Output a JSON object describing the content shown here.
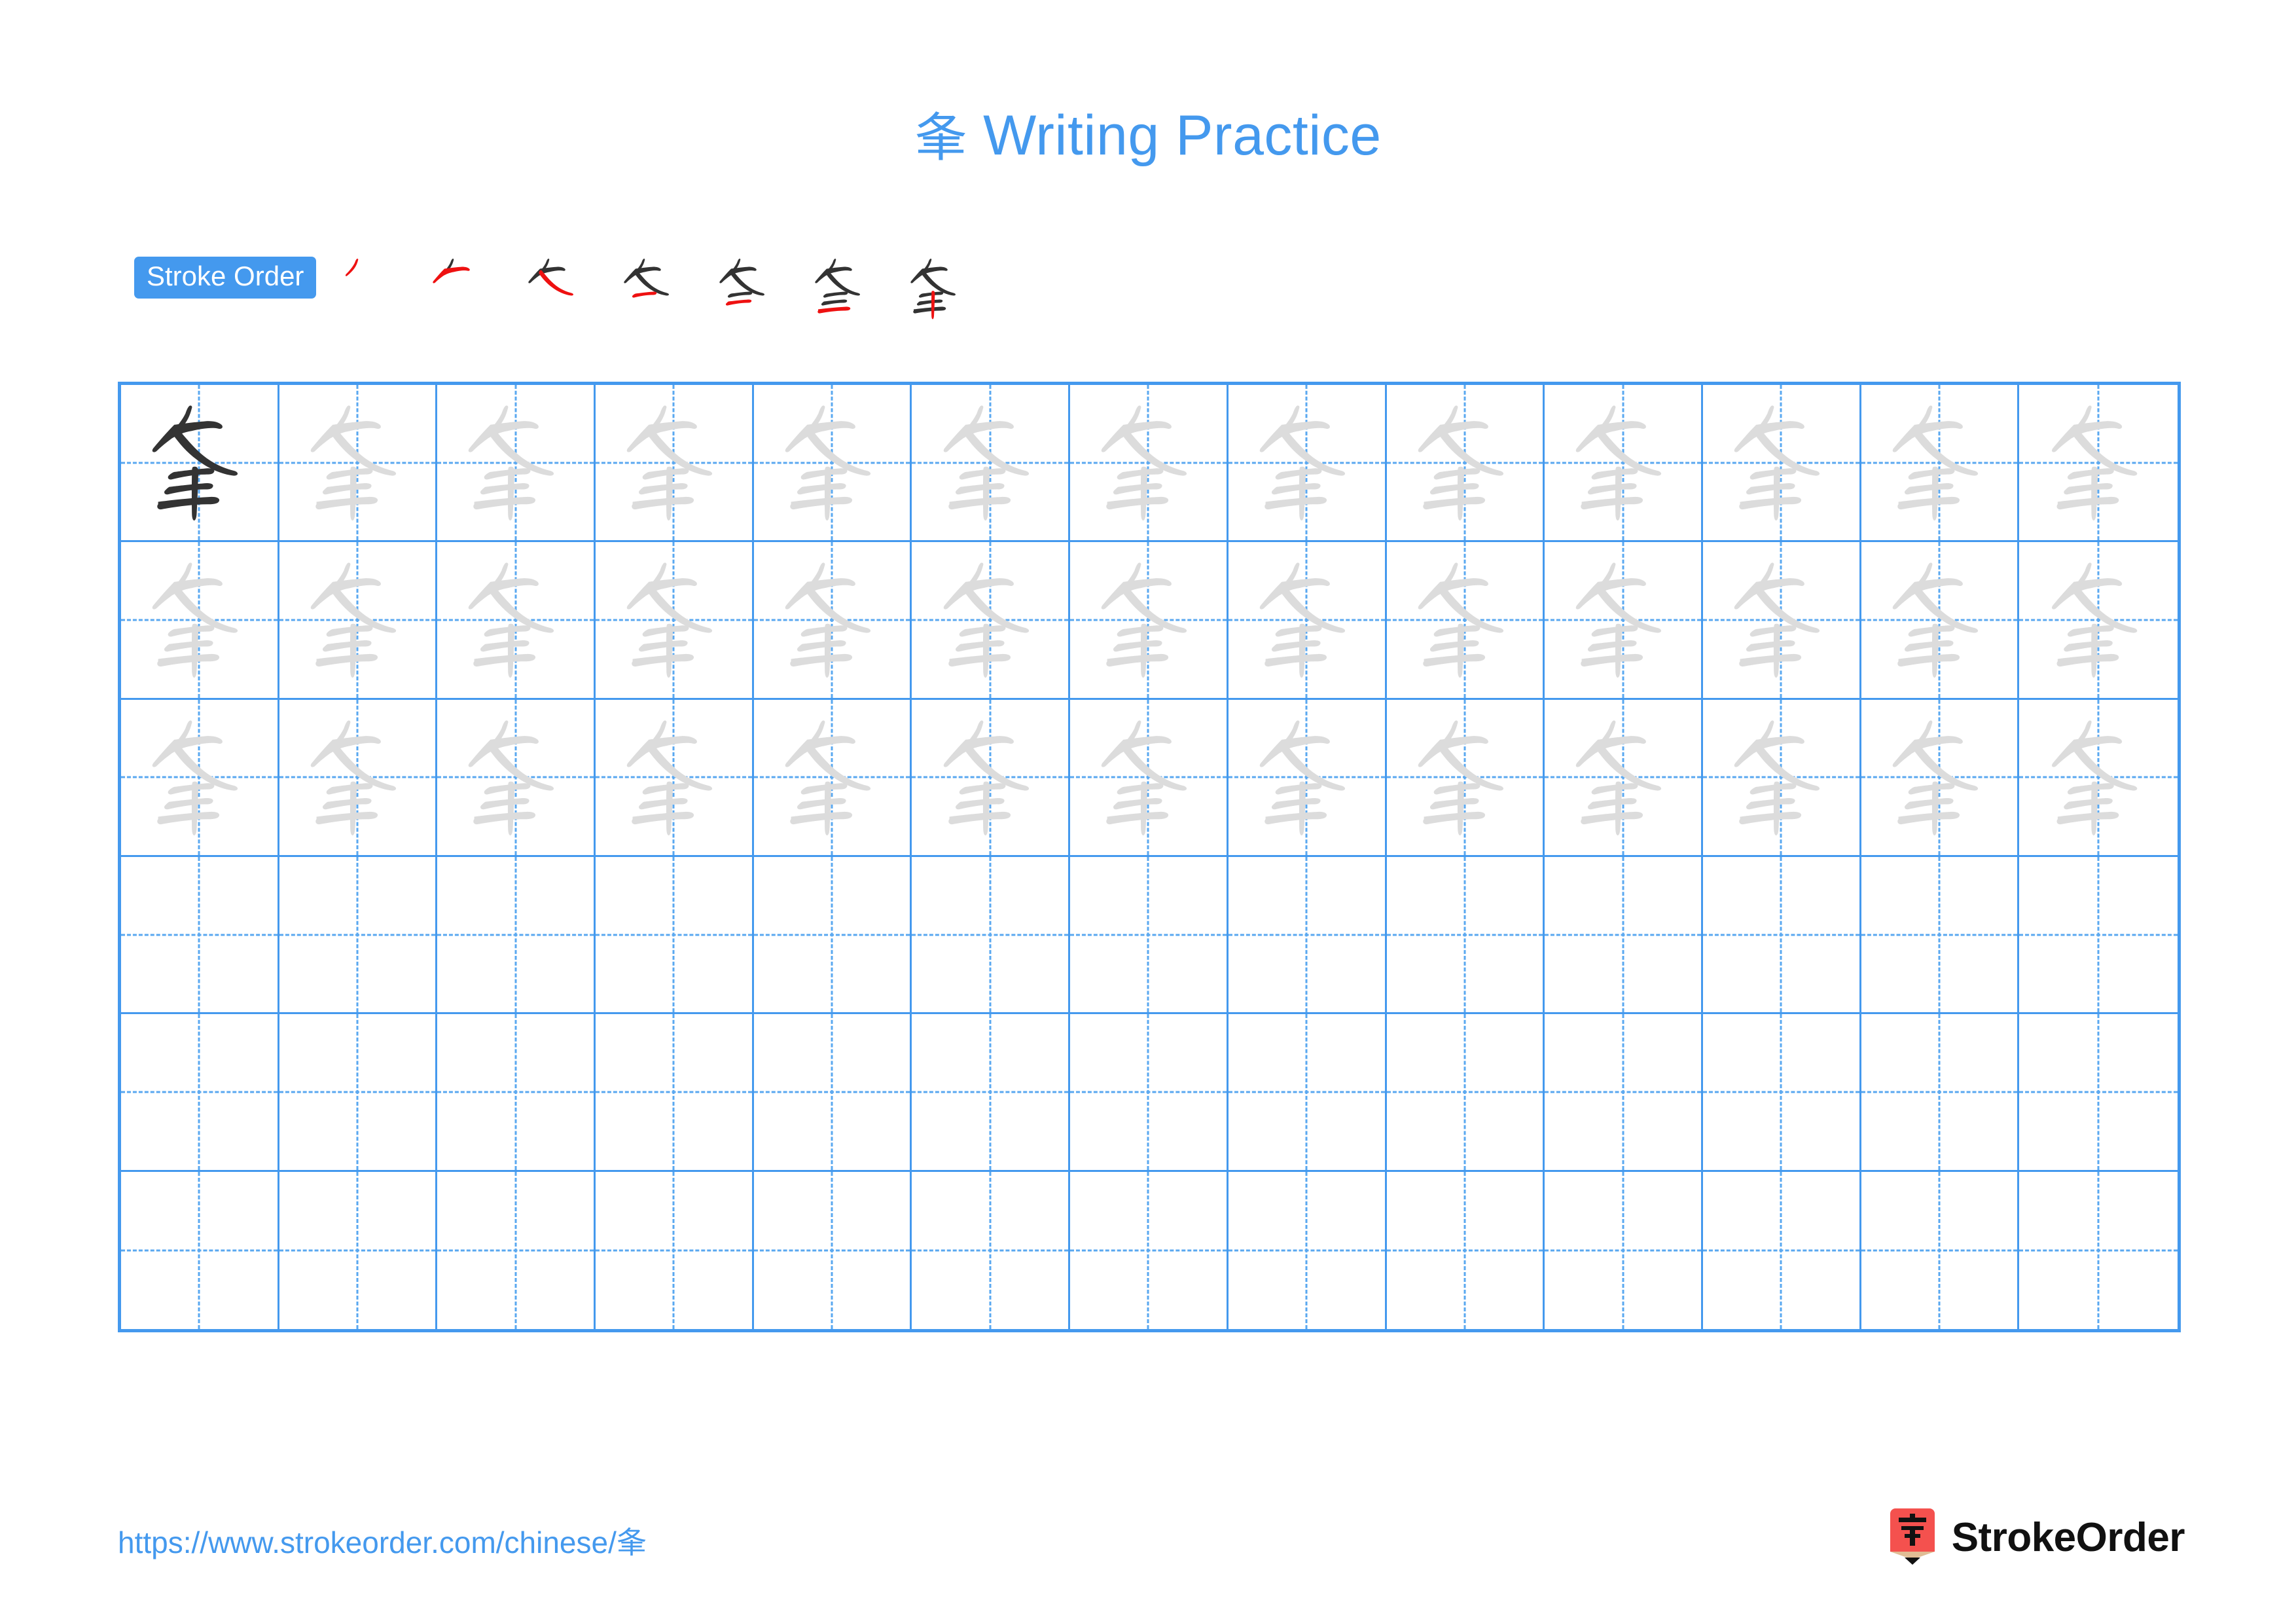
{
  "character": "夆",
  "title": {
    "char": "夆",
    "text": " Writing Practice",
    "full": "夆 Writing Practice"
  },
  "stroke_order": {
    "badge_label": "Stroke Order",
    "stroke_count": 7,
    "steps": [
      {
        "index": 1,
        "label": "stroke-1",
        "new_stroke": "丿"
      },
      {
        "index": 2,
        "label": "stroke-2",
        "new_stroke": "㇇"
      },
      {
        "index": 3,
        "label": "stroke-3",
        "new_stroke": "㇏"
      },
      {
        "index": 4,
        "label": "stroke-4",
        "new_stroke": "一"
      },
      {
        "index": 5,
        "label": "stroke-5",
        "new_stroke": "一"
      },
      {
        "index": 6,
        "label": "stroke-6",
        "new_stroke": "一"
      },
      {
        "index": 7,
        "label": "stroke-7",
        "new_stroke": "丨"
      }
    ]
  },
  "practice_grid": {
    "columns": 13,
    "rows": 6,
    "cells": [
      [
        "dark",
        "gray",
        "gray",
        "gray",
        "gray",
        "gray",
        "gray",
        "gray",
        "gray",
        "gray",
        "gray",
        "gray",
        "gray"
      ],
      [
        "gray",
        "gray",
        "gray",
        "gray",
        "gray",
        "gray",
        "gray",
        "gray",
        "gray",
        "gray",
        "gray",
        "gray",
        "gray"
      ],
      [
        "gray",
        "gray",
        "gray",
        "gray",
        "gray",
        "gray",
        "gray",
        "gray",
        "gray",
        "gray",
        "gray",
        "gray",
        "gray"
      ],
      [
        "empty",
        "empty",
        "empty",
        "empty",
        "empty",
        "empty",
        "empty",
        "empty",
        "empty",
        "empty",
        "empty",
        "empty",
        "empty"
      ],
      [
        "empty",
        "empty",
        "empty",
        "empty",
        "empty",
        "empty",
        "empty",
        "empty",
        "empty",
        "empty",
        "empty",
        "empty",
        "empty"
      ],
      [
        "empty",
        "empty",
        "empty",
        "empty",
        "empty",
        "empty",
        "empty",
        "empty",
        "empty",
        "empty",
        "empty",
        "empty",
        "empty"
      ]
    ]
  },
  "footer": {
    "url": "https://www.strokeorder.com/chinese/夆",
    "brand_name": "StrokeOrder",
    "logo_char": "字"
  },
  "colors": {
    "accent_blue": "#4499ee",
    "grid_line": "#4499ee",
    "guide_dash": "#5aa8f0",
    "ink_dark": "#333333",
    "ink_gray": "#dcdcdc",
    "stroke_highlight": "#ee1111",
    "logo_red": "#f4514e",
    "logo_wood": "#e0bd95"
  }
}
